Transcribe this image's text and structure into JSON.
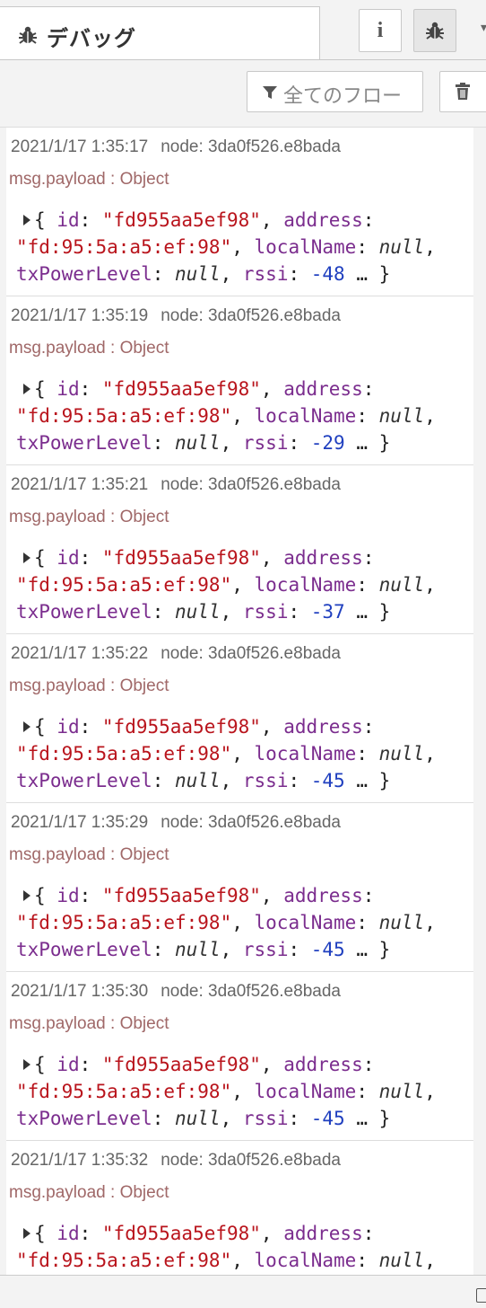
{
  "sidebar": {
    "tab_title": "デバッグ",
    "tab_icon": "bug-icon",
    "buttons": [
      {
        "name": "info-button",
        "icon": "info-icon"
      },
      {
        "name": "debug-button",
        "icon": "bug-icon",
        "active": true
      }
    ]
  },
  "toolbar": {
    "filter_label": "全てのフロー",
    "filter_icon": "filter-icon",
    "clear_icon": "trash-icon"
  },
  "messages": [
    {
      "time": "2021/1/17 1:35:17",
      "node": "node: 3da0f526.e8bada",
      "topic": "msg.payload : Object",
      "id": "\"fd955aa5ef98\"",
      "address": "\"fd:95:5a:a5:ef:98\"",
      "localName": "null",
      "txPowerLevel": "null",
      "rssi": "-48"
    },
    {
      "time": "2021/1/17 1:35:19",
      "node": "node: 3da0f526.e8bada",
      "topic": "msg.payload : Object",
      "id": "\"fd955aa5ef98\"",
      "address": "\"fd:95:5a:a5:ef:98\"",
      "localName": "null",
      "txPowerLevel": "null",
      "rssi": "-29"
    },
    {
      "time": "2021/1/17 1:35:21",
      "node": "node: 3da0f526.e8bada",
      "topic": "msg.payload : Object",
      "id": "\"fd955aa5ef98\"",
      "address": "\"fd:95:5a:a5:ef:98\"",
      "localName": "null",
      "txPowerLevel": "null",
      "rssi": "-37"
    },
    {
      "time": "2021/1/17 1:35:22",
      "node": "node: 3da0f526.e8bada",
      "topic": "msg.payload : Object",
      "id": "\"fd955aa5ef98\"",
      "address": "\"fd:95:5a:a5:ef:98\"",
      "localName": "null",
      "txPowerLevel": "null",
      "rssi": "-45"
    },
    {
      "time": "2021/1/17 1:35:29",
      "node": "node: 3da0f526.e8bada",
      "topic": "msg.payload : Object",
      "id": "\"fd955aa5ef98\"",
      "address": "\"fd:95:5a:a5:ef:98\"",
      "localName": "null",
      "txPowerLevel": "null",
      "rssi": "-45"
    },
    {
      "time": "2021/1/17 1:35:30",
      "node": "node: 3da0f526.e8bada",
      "topic": "msg.payload : Object",
      "id": "\"fd955aa5ef98\"",
      "address": "\"fd:95:5a:a5:ef:98\"",
      "localName": "null",
      "txPowerLevel": "null",
      "rssi": "-45"
    },
    {
      "time": "2021/1/17 1:35:32",
      "node": "node: 3da0f526.e8bada",
      "topic": "msg.payload : Object",
      "id": "\"fd955aa5ef98\"",
      "address": "\"fd:95:5a:a5:ef:98\"",
      "localName": "null"
    }
  ],
  "payload_syntax": {
    "open": "{",
    "close": "}",
    "ellipsis": "…",
    "key_id": "id",
    "key_address": "address",
    "key_localName": "localName",
    "key_txPowerLevel": "txPowerLevel",
    "key_rssi": "rssi"
  },
  "colors": {
    "key": "#7b2d8e",
    "string": "#b9141c",
    "number": "#1f3fbf",
    "topic": "#a06868"
  }
}
